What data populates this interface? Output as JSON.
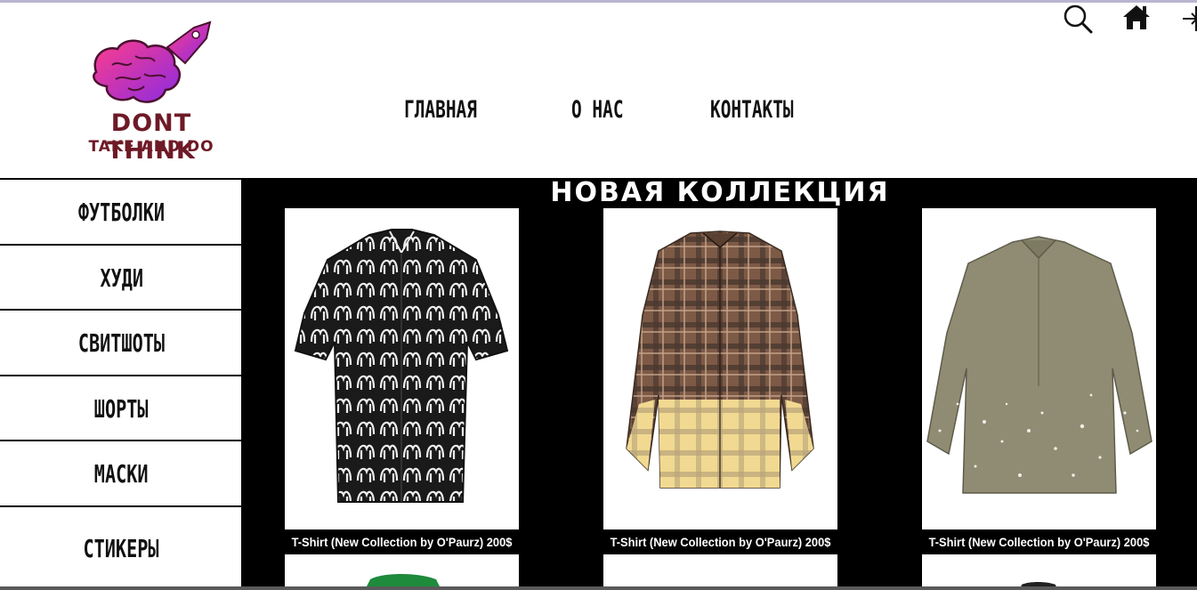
{
  "brand": {
    "line1": "DONT THINK",
    "line2": "TAKE AND DO"
  },
  "nav": {
    "items": [
      {
        "label": "ГЛАВНАЯ"
      },
      {
        "label": "О НАС"
      },
      {
        "label": "КОНТАКТЫ"
      }
    ]
  },
  "icons": {
    "search": "search-icon",
    "home": "home-icon",
    "login": "login-icon"
  },
  "sidebar": {
    "items": [
      {
        "label": "ФУТБОЛКИ"
      },
      {
        "label": "ХУДИ"
      },
      {
        "label": "СВИТШОТЫ"
      },
      {
        "label": "ШОРТЫ"
      },
      {
        "label": "МАСКИ"
      },
      {
        "label": "СТИКЕРЫ"
      }
    ]
  },
  "main": {
    "title": "НОВАЯ КОЛЛЕКЦИЯ",
    "products": [
      {
        "caption": "T-Shirt (New Collection by O'Paurz) 200$",
        "image": "black-white-gothic-print-shirt"
      },
      {
        "caption": "T-Shirt (New Collection by O'Paurz) 200$",
        "image": "brown-plaid-bleached-shirt"
      },
      {
        "caption": "T-Shirt (New Collection by O'Paurz) 200$",
        "image": "olive-paint-splatter-shirt"
      }
    ]
  },
  "colors": {
    "brand_text": "#6e1a27",
    "main_bg": "#000000",
    "logo_gradient_start": "#ff3d8b",
    "logo_gradient_end": "#8a2be2"
  }
}
